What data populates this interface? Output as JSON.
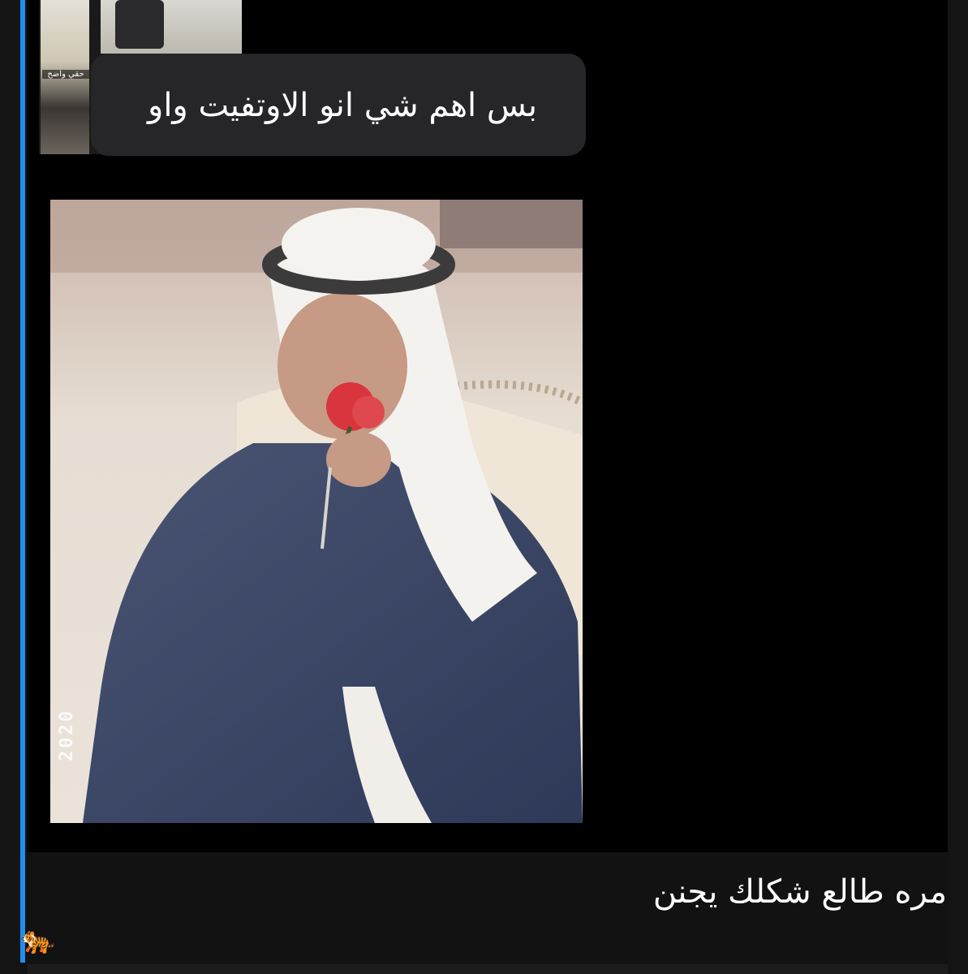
{
  "story": {
    "thumb_caption": "حقي واضح"
  },
  "message": {
    "text": "بس اهم شي انو الاوتفيت واو"
  },
  "photo": {
    "stamp": "2020"
  },
  "reply": {
    "text": "مره طالع شكلك يجنن",
    "emoji": "🐅"
  },
  "colors": {
    "accent_line": "#1f8ef0",
    "bubble": "#262628",
    "background": "#000000"
  }
}
